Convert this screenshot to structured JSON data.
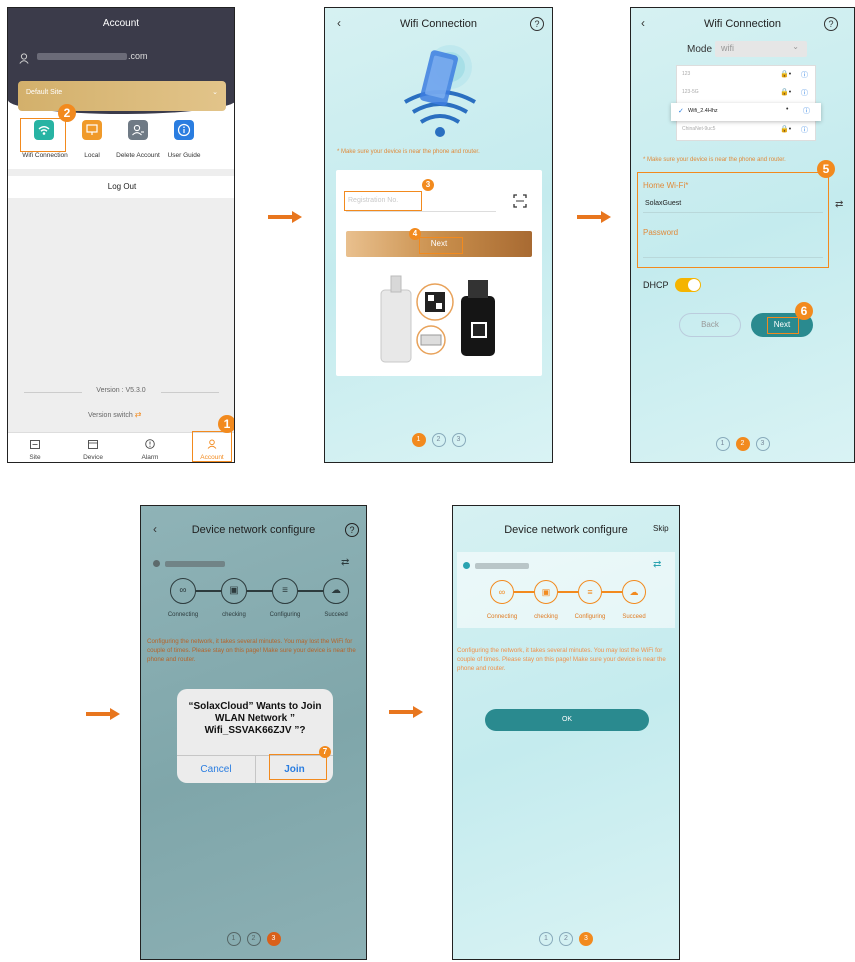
{
  "colors": {
    "accent": "#f28a1e",
    "teal": "#2a8a8f",
    "dark_header": "#3b3b4a",
    "gold": "#d9b472"
  },
  "screen1": {
    "title": "Account",
    "email_suffix": ".com",
    "site_select": "Default Site",
    "tiles": [
      {
        "label": "Wifi Connection",
        "icon": "wifi-icon"
      },
      {
        "label": "Local",
        "icon": "monitor-icon"
      },
      {
        "label": "Delete Account",
        "icon": "user-delete-icon"
      },
      {
        "label": "User Guide",
        "icon": "info-icon"
      }
    ],
    "logout": "Log Out",
    "version": "Version : V5.3.0",
    "version_switch": "Version switch",
    "tabs": [
      "Site",
      "Device",
      "Alarm",
      "Account"
    ]
  },
  "screen2": {
    "title": "Wifi Connection",
    "notice": "* Make sure your device is near the phone and router.",
    "reg_placeholder": "Registration No.",
    "next": "Next",
    "steps": [
      "1",
      "2",
      "3"
    ]
  },
  "screen3": {
    "title": "Wifi Connection",
    "mode_label": "Mode",
    "mode_value": "wifi",
    "networks": [
      "123",
      "123-5G",
      "Wifi_2.4Hhz",
      "ChinaNet-9uc5"
    ],
    "selected_network": "Wifi_2.4Hhz",
    "notice": "* Make sure your device is near the phone and router.",
    "home_wifi_label": "Home Wi-Fi",
    "home_wifi_value": "SolaxGuest",
    "password_label": "Password",
    "dhcp_label": "DHCP",
    "back": "Back",
    "next": "Next",
    "steps": [
      "1",
      "2",
      "3"
    ]
  },
  "screen4": {
    "title": "Device network configure",
    "stages": [
      "Connecting",
      "checking",
      "Configuring",
      "Succeed"
    ],
    "message": "Configuring the network, it takes several minutes. You may lost the WiFi for couple of times. Please stay on this page! Make sure your device is near the phone and router.",
    "dialog_title": "“SolaxCloud” Wants to Join WLAN Network ” Wifi_SSVAK66ZJV ”?",
    "cancel": "Cancel",
    "join": "Join",
    "steps": [
      "1",
      "2",
      "3"
    ]
  },
  "screen5": {
    "title": "Device network configure",
    "skip": "Skip",
    "stages": [
      "Connecting",
      "checking",
      "Configuring",
      "Succeed"
    ],
    "message": "Configuring the network, it takes several minutes. You may lost the WiFi for couple of times. Please stay on this page! Make sure your device is near the phone and router.",
    "ok": "OK",
    "steps": [
      "1",
      "2",
      "3"
    ]
  },
  "badges": [
    "1",
    "2",
    "3",
    "4",
    "5",
    "6",
    "7"
  ]
}
